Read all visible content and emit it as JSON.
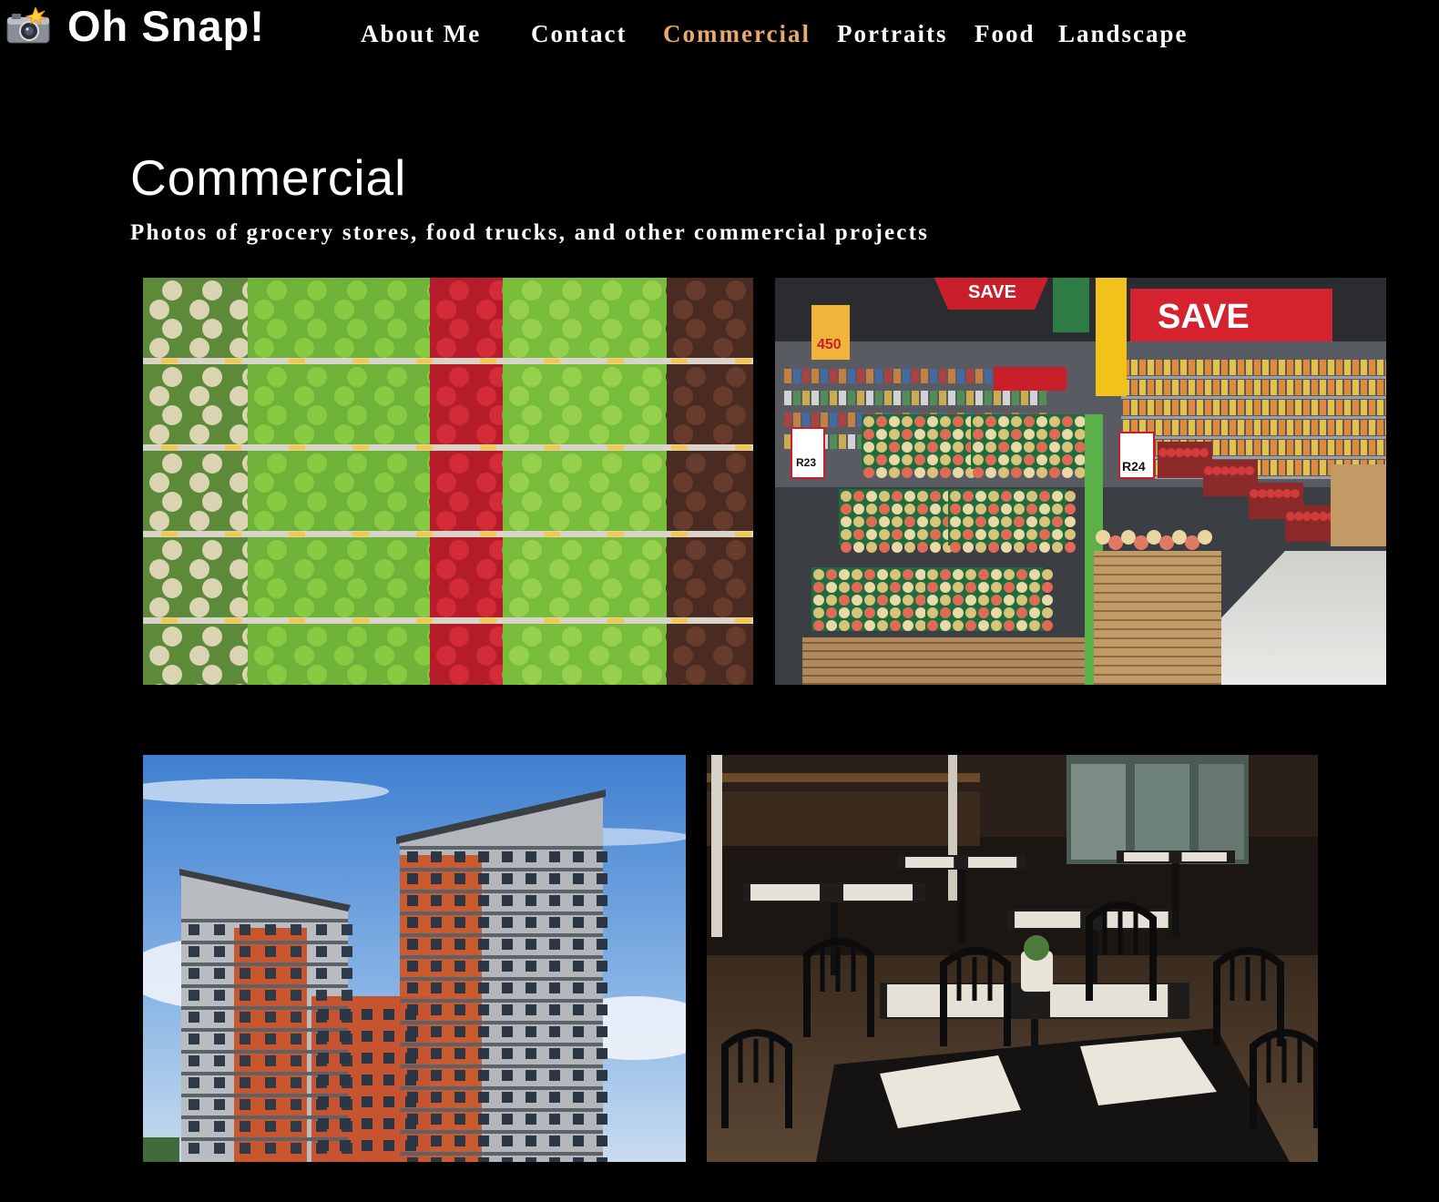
{
  "header": {
    "logo_icon": "camera-flash-icon",
    "brand": "Oh Snap!"
  },
  "nav": {
    "items": [
      {
        "label": "About Me",
        "active": false
      },
      {
        "label": "Contact",
        "active": false
      },
      {
        "label": "Commercial",
        "active": true
      },
      {
        "label": "Portraits",
        "active": false
      },
      {
        "label": "Food",
        "active": false
      },
      {
        "label": "Landscape",
        "active": false
      }
    ],
    "active_color": "#e8a96a"
  },
  "main": {
    "title": "Commercial",
    "subtitle": "Photos of grocery stores, food trucks, and other commercial projects"
  },
  "gallery": {
    "market_signs": {
      "save": "SAVE",
      "price_a": "R24",
      "price_b": "R23",
      "promo": "450"
    }
  }
}
